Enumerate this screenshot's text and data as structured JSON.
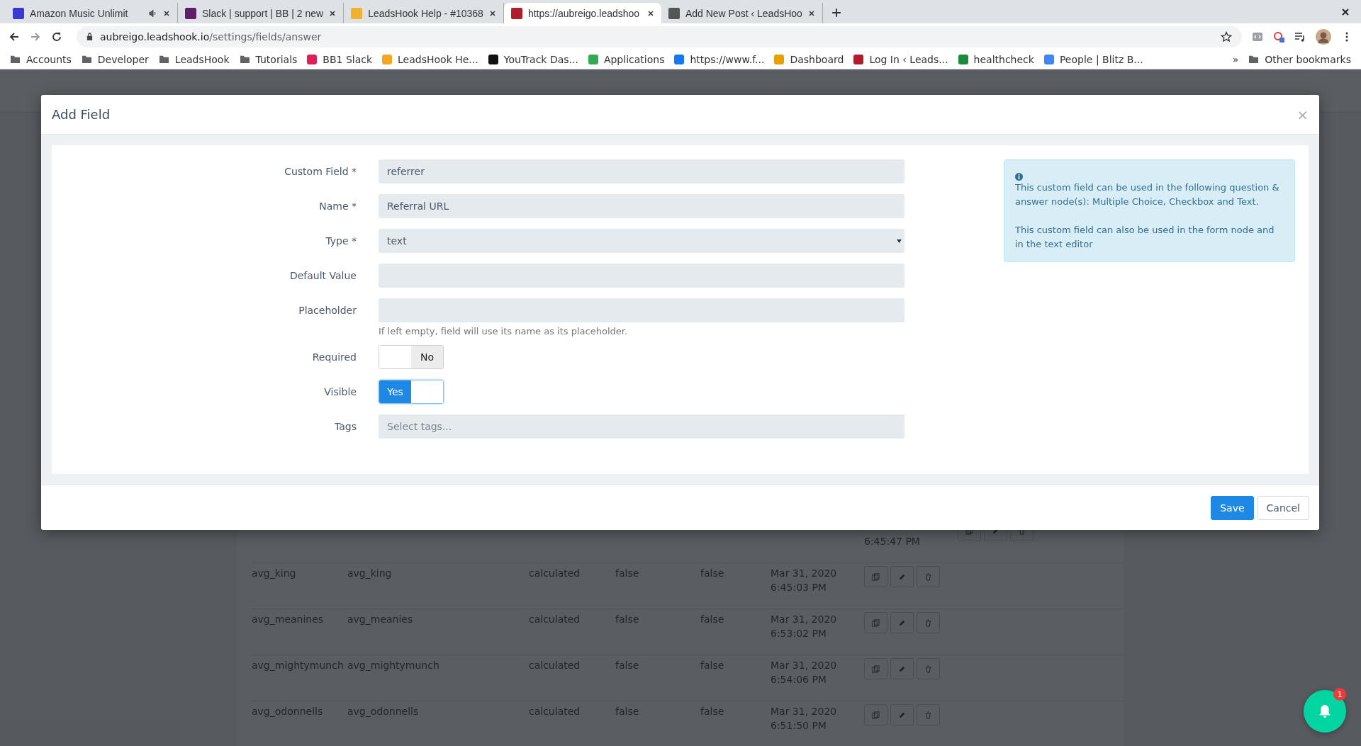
{
  "browser": {
    "tabs": [
      {
        "title": "Amazon Music Unlimit",
        "selected": false,
        "audio": true
      },
      {
        "title": "Slack | support | BB | 2 new",
        "selected": false,
        "audio": false
      },
      {
        "title": "LeadsHook Help - #10368",
        "selected": false,
        "audio": false
      },
      {
        "title": "https://aubreigo.leadshoo",
        "selected": true,
        "audio": false
      },
      {
        "title": "Add New Post ‹ LeadsHoo",
        "selected": false,
        "audio": false
      }
    ],
    "url_host": "aubreigo.leadshook.io",
    "url_path": "/settings/fields/answer",
    "bookmarks": [
      {
        "label": "Accounts",
        "kind": "folder"
      },
      {
        "label": "Developer",
        "kind": "folder"
      },
      {
        "label": "LeadsHook",
        "kind": "folder"
      },
      {
        "label": "Tutorials",
        "kind": "folder"
      },
      {
        "label": "BB1 Slack",
        "kind": "site"
      },
      {
        "label": "LeadsHook He...",
        "kind": "site"
      },
      {
        "label": "YouTrack Das...",
        "kind": "site"
      },
      {
        "label": "Applications",
        "kind": "site"
      },
      {
        "label": "https://www.f...",
        "kind": "site"
      },
      {
        "label": "Dashboard",
        "kind": "site"
      },
      {
        "label": "Log In ‹ Leads...",
        "kind": "site"
      },
      {
        "label": "healthcheck",
        "kind": "site"
      },
      {
        "label": "People | Blitz B...",
        "kind": "site"
      }
    ],
    "more": "»",
    "other_bookmarks": "Other bookmarks"
  },
  "background_table": {
    "rows": [
      {
        "time": "6:45:47 PM"
      },
      {
        "cells": [
          "avg_king",
          "avg_king",
          "calculated",
          "false",
          "false"
        ],
        "date": "Mar 31, 2020",
        "time": "6:45:03 PM"
      },
      {
        "cells": [
          "avg_meanines",
          "avg_meanies",
          "calculated",
          "false",
          "false"
        ],
        "date": "Mar 31, 2020",
        "time": "6:53:02 PM"
      },
      {
        "cells": [
          "avg_mightymunch",
          "avg_mightymunch",
          "calculated",
          "false",
          "false"
        ],
        "date": "Mar 31, 2020",
        "time": "6:54:06 PM"
      },
      {
        "cells": [
          "avg_odonnells",
          "avg_odonnells",
          "calculated",
          "false",
          "false"
        ],
        "date": "Mar 31, 2020",
        "time": "6:51:50 PM"
      }
    ]
  },
  "modal": {
    "title": "Add Field",
    "close": "×",
    "fields": [
      {
        "kind": "input",
        "label": "Custom Field *",
        "value": "referrer"
      },
      {
        "kind": "input",
        "label": "Name *",
        "value": "Referral URL"
      },
      {
        "kind": "select",
        "label": "Type *",
        "value": "text"
      },
      {
        "kind": "input",
        "label": "Default Value"
      },
      {
        "kind": "input",
        "label": "Placeholder",
        "help": "If left empty, field will use its name as its placeholder."
      },
      {
        "kind": "toggle",
        "label": "Required",
        "on": false,
        "state_text": "No"
      },
      {
        "kind": "toggle",
        "label": "Visible",
        "on": true,
        "state_text": "Yes"
      },
      {
        "kind": "tags",
        "label": "Tags",
        "placeholder": "Select tags..."
      }
    ],
    "info": [
      "This custom field can be used in the following question & answer node(s): Multiple Choice, Checkbox and Text.",
      "This custom field can also be used in the form node and in the text editor"
    ],
    "buttons": [
      {
        "label": "Save",
        "kind": "primary"
      },
      {
        "label": "Cancel",
        "kind": "secondary"
      }
    ]
  },
  "notification": {
    "count": "1"
  }
}
